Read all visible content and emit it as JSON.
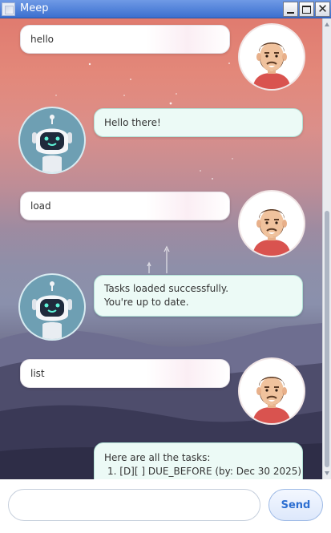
{
  "window": {
    "title": "Meep",
    "minimize_icon": "minimize-icon",
    "maximize_icon": "maximize-icon",
    "close_glyph": "✕"
  },
  "messages": [
    {
      "sender": "user",
      "avatar": "user-avatar",
      "lines": [
        "hello"
      ]
    },
    {
      "sender": "bot",
      "avatar": "robot-avatar",
      "lines": [
        "Hello there!"
      ]
    },
    {
      "sender": "user",
      "avatar": "user-avatar",
      "lines": [
        "load"
      ]
    },
    {
      "sender": "bot",
      "avatar": "robot-avatar",
      "lines": [
        "Tasks loaded successfully.",
        "You're up to date."
      ]
    },
    {
      "sender": "user",
      "avatar": "user-avatar",
      "lines": [
        "list"
      ]
    },
    {
      "sender": "bot",
      "avatar": "robot-avatar",
      "lines": [
        "Here are all the tasks:",
        "1. [D][ ] DUE_BEFORE (by: Dec 30 2025)"
      ]
    }
  ],
  "input": {
    "value": "",
    "placeholder": ""
  },
  "send_button": {
    "label": "Send"
  },
  "colors": {
    "user_bubble": "#ffffff",
    "bot_bubble": "#ecfaf6",
    "bot_bubble_border": "#b4e3d8",
    "send_text": "#2d6fd1",
    "title_bar": "#4f80d8"
  }
}
